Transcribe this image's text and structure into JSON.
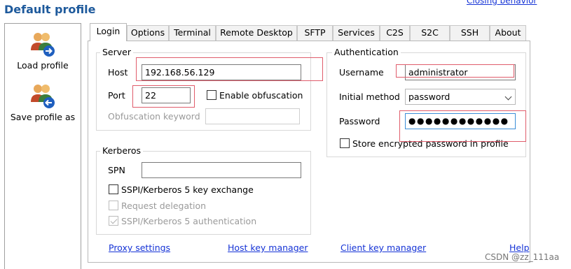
{
  "header": {
    "title": "Default profile",
    "closing_link": "Closing behavior"
  },
  "sidebar": {
    "load_label": "Load profile",
    "save_label": "Save profile as"
  },
  "tabs": [
    "Login",
    "Options",
    "Terminal",
    "Remote Desktop",
    "SFTP",
    "Services",
    "C2S",
    "S2C",
    "SSH",
    "About"
  ],
  "server": {
    "group_label": "Server",
    "host_label": "Host",
    "host_value": "192.168.56.129",
    "port_label": "Port",
    "port_value": "22",
    "obfuscation_label": "Enable obfuscation",
    "obfuscation_keyword_label": "Obfuscation keyword",
    "obfuscation_keyword_value": ""
  },
  "kerberos": {
    "group_label": "Kerberos",
    "spn_label": "SPN",
    "spn_value": "",
    "key_exchange_label": "SSPI/Kerberos 5 key exchange",
    "delegation_label": "Request delegation",
    "authentication_label": "SSPI/Kerberos 5 authentication"
  },
  "authentication": {
    "group_label": "Authentication",
    "username_label": "Username",
    "username_value": "administrator",
    "method_label": "Initial method",
    "method_value": "password",
    "password_label": "Password",
    "password_value": "●●●●●●●●●●●●",
    "store_label": "Store encrypted password in profile"
  },
  "links": {
    "proxy": "Proxy settings",
    "host_key": "Host key manager",
    "client_key": "Client key manager",
    "help": "Help"
  },
  "watermark": "CSDN @zz_111aa",
  "colors": {
    "title": "#1e5a9c",
    "link": "#1533d6",
    "highlight": "#e05c6b"
  }
}
